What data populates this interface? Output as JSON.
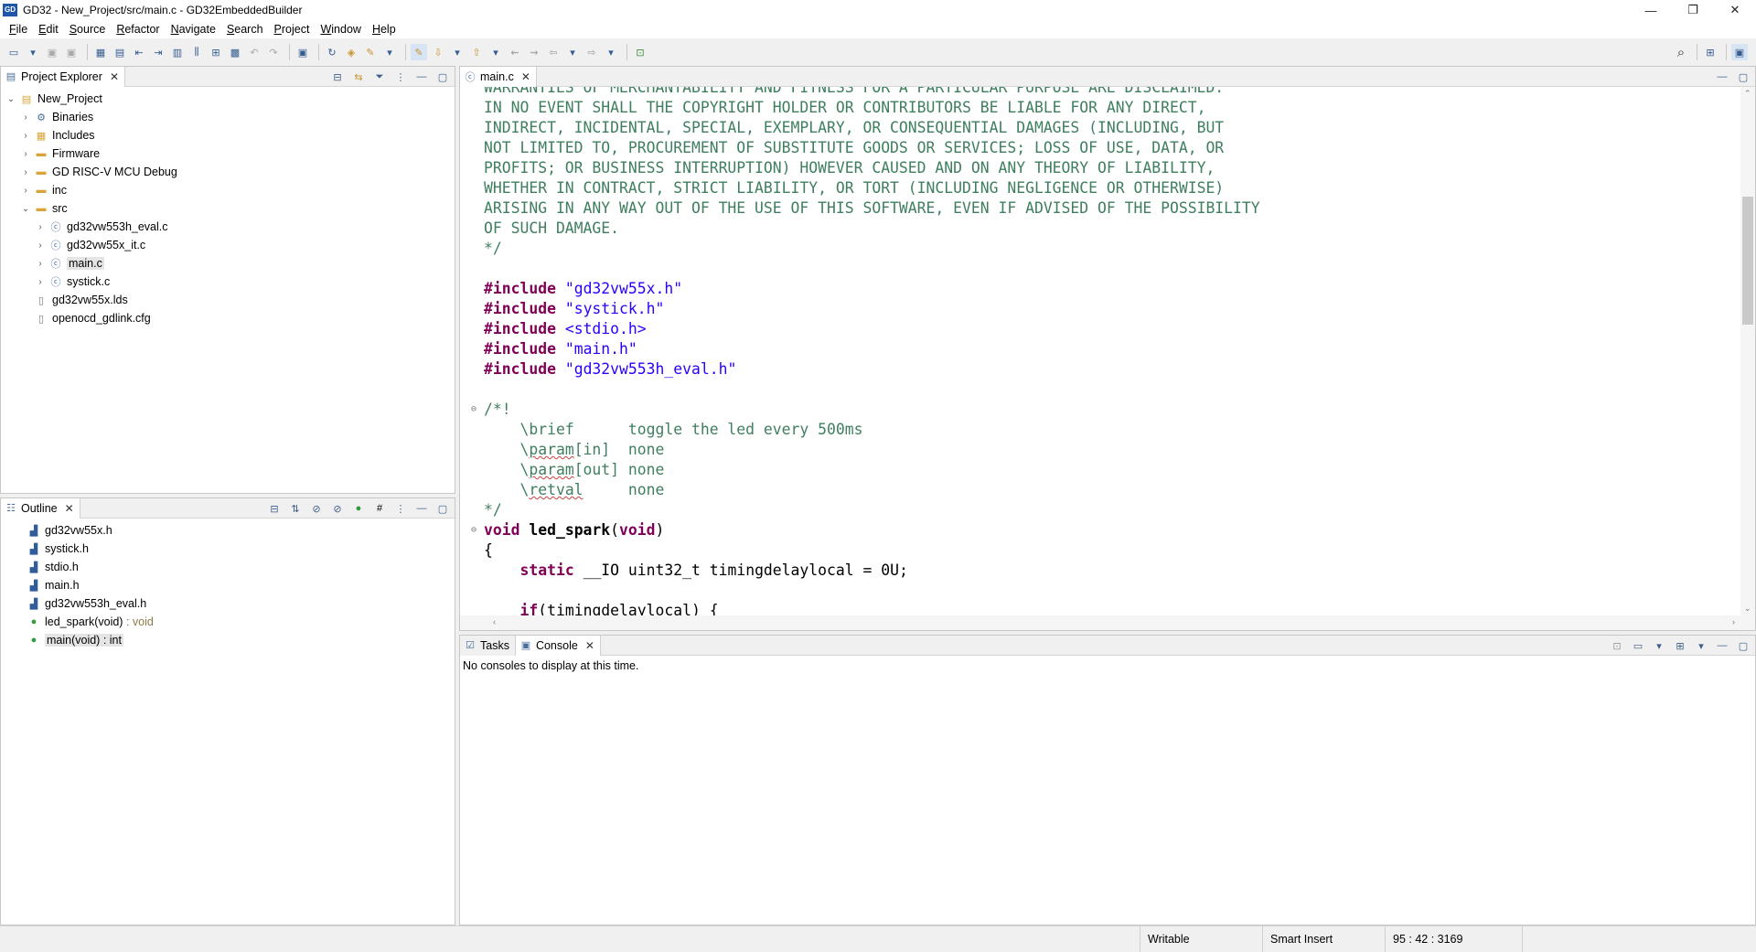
{
  "window": {
    "logo": "GD",
    "title": "GD32 - New_Project/src/main.c - GD32EmbeddedBuilder",
    "minimize": "—",
    "restore": "❐",
    "close": "✕"
  },
  "menu": [
    "File",
    "Edit",
    "Source",
    "Refactor",
    "Navigate",
    "Search",
    "Project",
    "Window",
    "Help"
  ],
  "project_explorer": {
    "tab_label": "Project Explorer",
    "items": [
      {
        "label": "New_Project",
        "level": 0,
        "twisty": "open",
        "icon": "project-icon"
      },
      {
        "label": "Binaries",
        "level": 1,
        "twisty": "closed",
        "icon": "binaries-icon"
      },
      {
        "label": "Includes",
        "level": 1,
        "twisty": "closed",
        "icon": "includes-icon"
      },
      {
        "label": "Firmware",
        "level": 1,
        "twisty": "closed",
        "icon": "folder-icon"
      },
      {
        "label": "GD RISC-V MCU Debug",
        "level": 1,
        "twisty": "closed",
        "icon": "folder-icon"
      },
      {
        "label": "inc",
        "level": 1,
        "twisty": "closed",
        "icon": "folder-icon"
      },
      {
        "label": "src",
        "level": 1,
        "twisty": "open",
        "icon": "folder-icon"
      },
      {
        "label": "gd32vw553h_eval.c",
        "level": 2,
        "twisty": "closed",
        "icon": "c-file-icon"
      },
      {
        "label": "gd32vw55x_it.c",
        "level": 2,
        "twisty": "closed",
        "icon": "c-file-icon"
      },
      {
        "label": "main.c",
        "level": 2,
        "twisty": "closed",
        "icon": "c-file-icon",
        "selected": true
      },
      {
        "label": "systick.c",
        "level": 2,
        "twisty": "closed",
        "icon": "c-file-icon"
      },
      {
        "label": "gd32vw55x.lds",
        "level": 1,
        "twisty": "none",
        "icon": "file-icon"
      },
      {
        "label": "openocd_gdlink.cfg",
        "level": 1,
        "twisty": "none",
        "icon": "file-icon"
      }
    ]
  },
  "outline": {
    "tab_label": "Outline",
    "items": [
      {
        "label": "gd32vw55x.h",
        "type": "",
        "icon": "include-icon"
      },
      {
        "label": "systick.h",
        "type": "",
        "icon": "include-icon"
      },
      {
        "label": "stdio.h",
        "type": "",
        "icon": "include-icon"
      },
      {
        "label": "main.h",
        "type": "",
        "icon": "include-icon"
      },
      {
        "label": "gd32vw553h_eval.h",
        "type": "",
        "icon": "include-icon"
      },
      {
        "label": "led_spark(void)",
        "type": " : void",
        "icon": "function-icon"
      },
      {
        "label": "main(void) : int",
        "type": "",
        "icon": "function-icon",
        "selected": true
      }
    ]
  },
  "editor": {
    "tab_label": "main.c",
    "lines": [
      {
        "fold": "",
        "segments": [
          {
            "c": "cm",
            "t": "WARRANTIES OF MERCHANTABILITY AND FITNESS FOR A PARTICULAR PURPOSE ARE DISCLAIMED."
          }
        ]
      },
      {
        "fold": "",
        "segments": [
          {
            "c": "cm",
            "t": "IN NO EVENT SHALL THE COPYRIGHT HOLDER OR CONTRIBUTORS BE LIABLE FOR ANY DIRECT,"
          }
        ]
      },
      {
        "fold": "",
        "segments": [
          {
            "c": "cm",
            "t": "INDIRECT, INCIDENTAL, SPECIAL, EXEMPLARY, OR CONSEQUENTIAL DAMAGES (INCLUDING, BUT"
          }
        ]
      },
      {
        "fold": "",
        "segments": [
          {
            "c": "cm",
            "t": "NOT LIMITED TO, PROCUREMENT OF SUBSTITUTE GOODS OR SERVICES; LOSS OF USE, DATA, OR"
          }
        ]
      },
      {
        "fold": "",
        "segments": [
          {
            "c": "cm",
            "t": "PROFITS; OR BUSINESS INTERRUPTION) HOWEVER CAUSED AND ON ANY THEORY OF LIABILITY,"
          }
        ]
      },
      {
        "fold": "",
        "segments": [
          {
            "c": "cm",
            "t": "WHETHER IN CONTRACT, STRICT LIABILITY, OR TORT (INCLUDING NEGLIGENCE OR OTHERWISE)"
          }
        ]
      },
      {
        "fold": "",
        "segments": [
          {
            "c": "cm",
            "t": "ARISING IN ANY WAY OUT OF THE USE OF THIS SOFTWARE, EVEN IF ADVISED OF THE POSSIBILITY"
          }
        ]
      },
      {
        "fold": "",
        "segments": [
          {
            "c": "cm",
            "t": "OF SUCH DAMAGE."
          }
        ]
      },
      {
        "fold": "",
        "segments": [
          {
            "c": "cm",
            "t": "*/"
          }
        ]
      },
      {
        "fold": "",
        "segments": []
      },
      {
        "fold": "",
        "segments": [
          {
            "c": "kw",
            "t": "#include"
          },
          {
            "c": "plain",
            "t": " "
          },
          {
            "c": "str",
            "t": "\"gd32vw55x.h\""
          }
        ]
      },
      {
        "fold": "",
        "segments": [
          {
            "c": "kw",
            "t": "#include"
          },
          {
            "c": "plain",
            "t": " "
          },
          {
            "c": "str",
            "t": "\"systick.h\""
          }
        ]
      },
      {
        "fold": "",
        "segments": [
          {
            "c": "kw",
            "t": "#include"
          },
          {
            "c": "plain",
            "t": " "
          },
          {
            "c": "str",
            "t": "<stdio.h>"
          }
        ]
      },
      {
        "fold": "",
        "segments": [
          {
            "c": "kw",
            "t": "#include"
          },
          {
            "c": "plain",
            "t": " "
          },
          {
            "c": "str",
            "t": "\"main.h\""
          }
        ]
      },
      {
        "fold": "",
        "segments": [
          {
            "c": "kw",
            "t": "#include"
          },
          {
            "c": "plain",
            "t": " "
          },
          {
            "c": "str",
            "t": "\"gd32vw553h_eval.h\""
          }
        ]
      },
      {
        "fold": "",
        "segments": []
      },
      {
        "fold": "⊖",
        "segments": [
          {
            "c": "cm",
            "t": "/*!"
          }
        ]
      },
      {
        "fold": "",
        "segments": [
          {
            "c": "cm",
            "t": "    \\brief      toggle the led every 500ms"
          }
        ]
      },
      {
        "fold": "",
        "segments": [
          {
            "c": "cm",
            "t": "    \\"
          },
          {
            "c": "cm squig",
            "t": "param"
          },
          {
            "c": "cm",
            "t": "[in]  none"
          }
        ]
      },
      {
        "fold": "",
        "segments": [
          {
            "c": "cm",
            "t": "    \\"
          },
          {
            "c": "cm squig",
            "t": "param"
          },
          {
            "c": "cm",
            "t": "[out] none"
          }
        ]
      },
      {
        "fold": "",
        "segments": [
          {
            "c": "cm",
            "t": "    \\"
          },
          {
            "c": "cm squig",
            "t": "retval"
          },
          {
            "c": "cm",
            "t": "     none"
          }
        ]
      },
      {
        "fold": "",
        "segments": [
          {
            "c": "cm",
            "t": "*/"
          }
        ]
      },
      {
        "fold": "⊖",
        "segments": [
          {
            "c": "kw",
            "t": "void"
          },
          {
            "c": "plain bold",
            "t": " led_spark"
          },
          {
            "c": "plain",
            "t": "("
          },
          {
            "c": "kw",
            "t": "void"
          },
          {
            "c": "plain",
            "t": ")"
          }
        ]
      },
      {
        "fold": "",
        "segments": [
          {
            "c": "plain",
            "t": "{"
          }
        ]
      },
      {
        "fold": "",
        "segments": [
          {
            "c": "plain",
            "t": "    "
          },
          {
            "c": "kw",
            "t": "static"
          },
          {
            "c": "plain",
            "t": " __IO uint32_t timingdelaylocal = 0U;"
          }
        ]
      },
      {
        "fold": "",
        "segments": []
      },
      {
        "fold": "",
        "segments": [
          {
            "c": "plain",
            "t": "    "
          },
          {
            "c": "kw",
            "t": "if"
          },
          {
            "c": "plain",
            "t": "(timingdelaylocal) {"
          }
        ]
      }
    ]
  },
  "bottom_panel": {
    "tabs": [
      {
        "label": "Tasks",
        "active": false
      },
      {
        "label": "Console",
        "active": true
      }
    ],
    "message": "No consoles to display at this time."
  },
  "status_bar": {
    "mode": "Writable",
    "insert": "Smart Insert",
    "position": "95 : 42 : 3169"
  },
  "colors": {
    "comment": "#3f7f5f",
    "keyword": "#7f0055",
    "string": "#2a00ff"
  }
}
